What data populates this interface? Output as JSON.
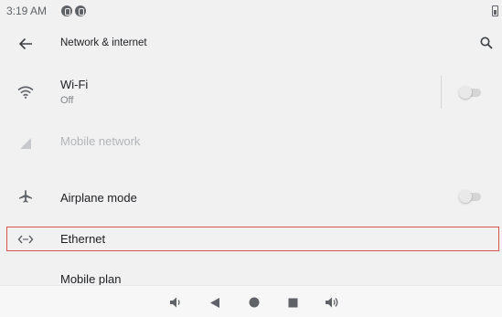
{
  "status_bar": {
    "time": "3:19 AM",
    "notification_icons": [
      "notification-icon",
      "notification-icon"
    ],
    "battery_icon": "battery-icon"
  },
  "app_bar": {
    "title": "Network & internet",
    "back_icon": "arrow-back-icon",
    "search_icon": "search-icon"
  },
  "settings": {
    "wifi": {
      "title": "Wi-Fi",
      "subtitle": "Off",
      "icon": "wifi-icon",
      "toggle_on": false
    },
    "mobile_network": {
      "title": "Mobile network",
      "icon": "signal-icon",
      "enabled": false
    },
    "airplane": {
      "title": "Airplane mode",
      "icon": "airplane-icon",
      "toggle_on": false
    },
    "ethernet": {
      "title": "Ethernet",
      "icon": "ethernet-icon"
    },
    "mobile_plan": {
      "title": "Mobile plan"
    }
  },
  "nav_bar": {
    "buttons": [
      "volume-down-icon",
      "back-triangle-icon",
      "home-circle-icon",
      "recents-square-icon",
      "volume-up-icon"
    ]
  },
  "colors": {
    "background": "#f1f1f1",
    "highlight_border": "#d9534f",
    "icon": "#5f6368"
  }
}
